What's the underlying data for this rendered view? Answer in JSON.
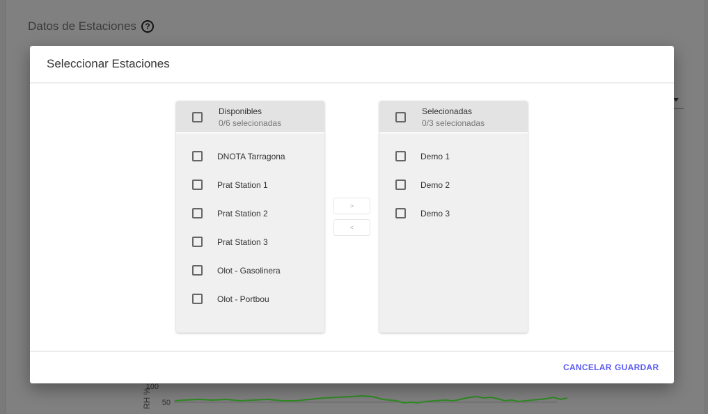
{
  "page": {
    "title": "Datos de Estaciones",
    "help_icon": "?"
  },
  "background_chart": {
    "y_ticks": [
      "100",
      "50"
    ],
    "y_label": "RH %",
    "line_color": "#2e8b22"
  },
  "dialog": {
    "title": "Seleccionar Estaciones",
    "available": {
      "title": "Disponibles",
      "count": "0/6 selecionadas",
      "items": [
        "DNOTA Tarragona",
        "Prat Station 1",
        "Prat Station 2",
        "Prat Station 3",
        "Olot - Gasolinera",
        "Olot - Portbou"
      ]
    },
    "selected": {
      "title": "Selecionadas",
      "count": "0/3 selecionadas",
      "items": [
        "Demo 1",
        "Demo 2",
        "Demo 3"
      ]
    },
    "move_right": ">",
    "move_left": "<",
    "cancel": "CANCELAR",
    "save": "GUARDAR",
    "accent": "#5b5bf5"
  }
}
